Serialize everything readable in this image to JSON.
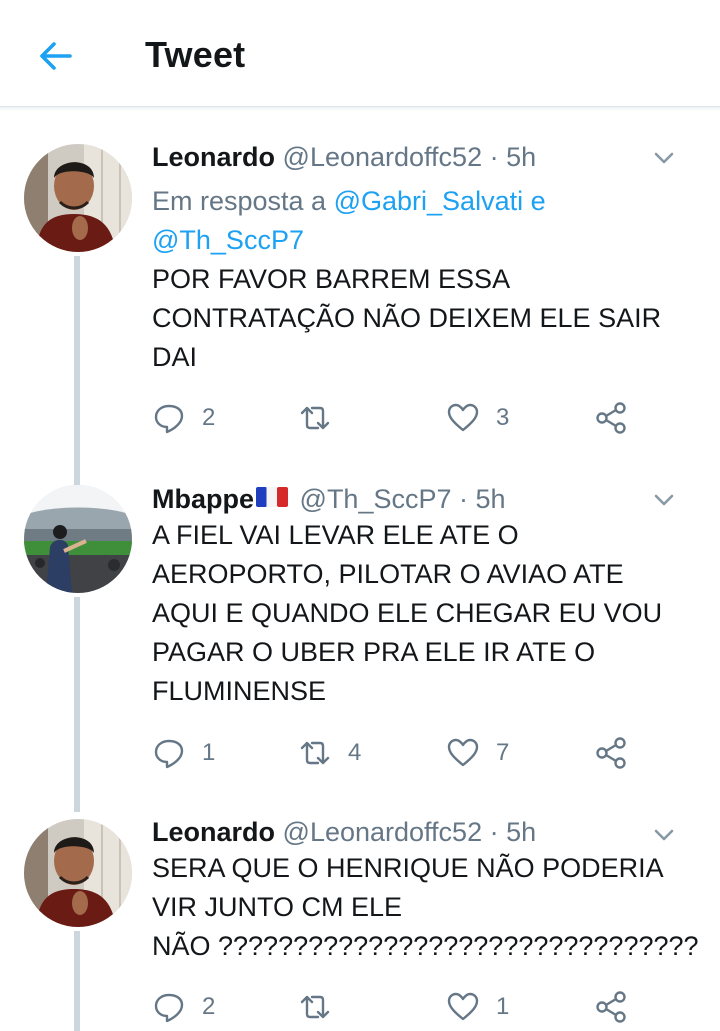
{
  "header": {
    "title": "Tweet",
    "back_icon": "arrow-left-icon",
    "accent": "#1da1f2"
  },
  "tweets": [
    {
      "name": "Leonardo",
      "handle": "@Leonardoffc52",
      "dot": "·",
      "time": "5h",
      "reply_prefix": "Em resposta a",
      "reply_mention_1": "@Gabri_Salvati",
      "reply_and": "e",
      "reply_mention_2": "@Th_SccP7",
      "text_lines": [
        "POR FAVOR BARREM ESSA",
        "CONTRATAÇÃO NÃO DEIXEM ELE SAIR",
        "DAI"
      ],
      "replies": "2",
      "retweets": "",
      "likes": "3"
    },
    {
      "name": "Mbappe",
      "flag": "france-flag-icon",
      "handle": "@Th_SccP7",
      "dot": "·",
      "time": "5h",
      "text_lines": [
        "A FIEL VAI LEVAR ELE ATE O",
        "AEROPORTO, PILOTAR O AVIAO ATE",
        "AQUI E QUANDO ELE CHEGAR EU VOU",
        "PAGAR O UBER PRA ELE IR ATE O",
        "FLUMINENSE"
      ],
      "replies": "1",
      "retweets": "4",
      "likes": "7"
    },
    {
      "name": "Leonardo",
      "handle": "@Leonardoffc52",
      "dot": "·",
      "time": "5h",
      "text_lines": [
        "SERA QUE O HENRIQUE NÃO PODERIA",
        "VIR JUNTO CM ELE",
        "NÃO ????????????????????????????????"
      ],
      "replies": "2",
      "retweets": "",
      "likes": "1"
    }
  ],
  "icons": {
    "reply": "reply-icon",
    "retweet": "retweet-icon",
    "like": "heart-icon",
    "share": "share-icon",
    "more": "chevron-down-icon"
  },
  "colors": {
    "text": "#14171a",
    "secondary": "#657786",
    "link": "#1da1f2",
    "thread_line": "#ccd6dd"
  }
}
